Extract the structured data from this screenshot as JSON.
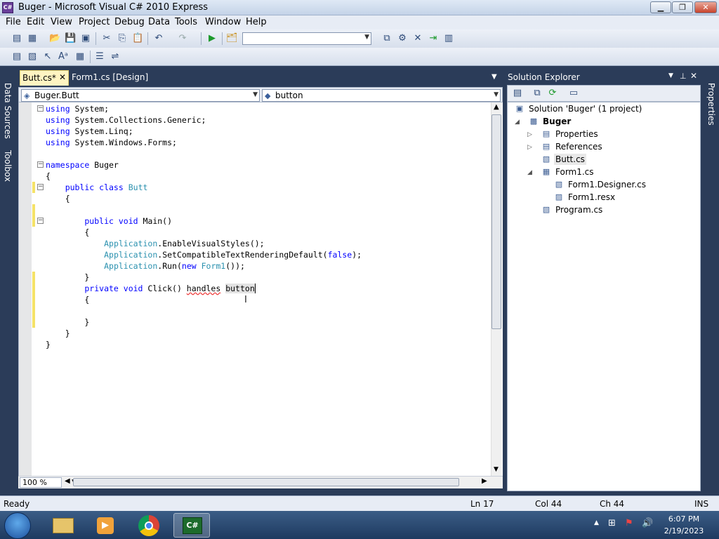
{
  "window": {
    "title": "Buger - Microsoft Visual C# 2010 Express",
    "icon_text": "C#"
  },
  "menu": [
    "File",
    "Edit",
    "View",
    "Project",
    "Debug",
    "Data",
    "Tools",
    "Window",
    "Help"
  ],
  "rails": {
    "left": [
      "Data Sources",
      "Toolbox"
    ],
    "right": [
      "Properties"
    ]
  },
  "tabs": {
    "active": "Butt.cs*",
    "close": "✕",
    "inactive": "Form1.cs [Design]"
  },
  "nav": {
    "type": "Buger.Butt",
    "member": "button"
  },
  "code": {
    "l1": [
      "using",
      " System;"
    ],
    "l2": [
      "using",
      " System.Collections.Generic;"
    ],
    "l3": [
      "using",
      " System.Linq;"
    ],
    "l4": [
      "using",
      " System.Windows.Forms;"
    ],
    "l6": [
      "namespace",
      " Buger"
    ],
    "l7": "{",
    "l8": [
      "    public class",
      " ",
      "Butt"
    ],
    "l9": "    {",
    "l11": [
      "        public void",
      " Main()"
    ],
    "l12": "        {",
    "l13": [
      "            ",
      "Application",
      ".EnableVisualStyles();"
    ],
    "l14": [
      "            ",
      "Application",
      ".SetCompatibleTextRenderingDefault(",
      "false",
      ");"
    ],
    "l15": [
      "            ",
      "Application",
      ".Run(",
      "new",
      " ",
      "Form1",
      "());"
    ],
    "l16": "        }",
    "l17": [
      "        private void",
      " Click() ",
      "handles",
      " ",
      "button"
    ],
    "l18": "        {",
    "l20": "        }",
    "l21": "    }",
    "l22": "}"
  },
  "zoom": "100 %",
  "solution_explorer": {
    "title": "Solution Explorer",
    "items": [
      "Solution 'Buger' (1 project)",
      "Buger",
      "Properties",
      "References",
      "Butt.cs",
      "Form1.cs",
      "Form1.Designer.cs",
      "Form1.resx",
      "Program.cs"
    ]
  },
  "status": {
    "ready": "Ready",
    "ln": "Ln 17",
    "col": "Col 44",
    "ch": "Ch 44",
    "mode": "INS"
  },
  "tray": {
    "time": "6:07 PM",
    "date": "2/19/2023"
  },
  "colors": {
    "keyword": "#0000ff",
    "type": "#2b91af",
    "frame": "#2b3c59"
  }
}
